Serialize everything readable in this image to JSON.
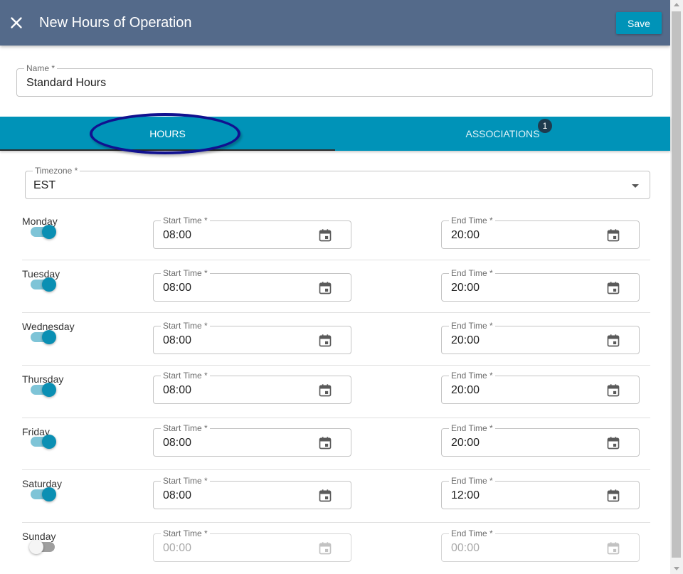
{
  "header": {
    "title": "New Hours of Operation",
    "close_icon": "close-icon",
    "save_label": "Save",
    "color": "#546a8a"
  },
  "name_field": {
    "label": "Name *",
    "value": "Standard Hours"
  },
  "tabs": [
    {
      "label": "HOURS",
      "active": true
    },
    {
      "label": "ASSOCIATIONS",
      "active": false,
      "badge": "1"
    }
  ],
  "timezone": {
    "label": "Timezone *",
    "value": "EST"
  },
  "days": [
    {
      "day": "Monday",
      "enabled": true,
      "start_label": "Start Time *",
      "start": "08:00",
      "end_label": "End Time *",
      "end": "20:00"
    },
    {
      "day": "Tuesday",
      "enabled": true,
      "start_label": "Start Time *",
      "start": "08:00",
      "end_label": "End Time *",
      "end": "20:00"
    },
    {
      "day": "Wednesday",
      "enabled": true,
      "start_label": "Start Time *",
      "start": "08:00",
      "end_label": "End Time *",
      "end": "20:00"
    },
    {
      "day": "Thursday",
      "enabled": true,
      "start_label": "Start Time *",
      "start": "08:00",
      "end_label": "End Time *",
      "end": "20:00"
    },
    {
      "day": "Friday",
      "enabled": true,
      "start_label": "Start Time *",
      "start": "08:00",
      "end_label": "End Time *",
      "end": "20:00"
    },
    {
      "day": "Saturday",
      "enabled": true,
      "start_label": "Start Time *",
      "start": "08:00",
      "end_label": "End Time *",
      "end": "12:00"
    },
    {
      "day": "Sunday",
      "enabled": false,
      "start_label": "Start Time *",
      "start": "00:00",
      "end_label": "End Time *",
      "end": "00:00"
    }
  ],
  "colors": {
    "accent": "#0093b8",
    "badge": "#1e3a4e",
    "annotation_ring": "#11118f"
  },
  "icons": {
    "calendar": "calendar-icon",
    "dropdown": "chevron-down-icon"
  }
}
